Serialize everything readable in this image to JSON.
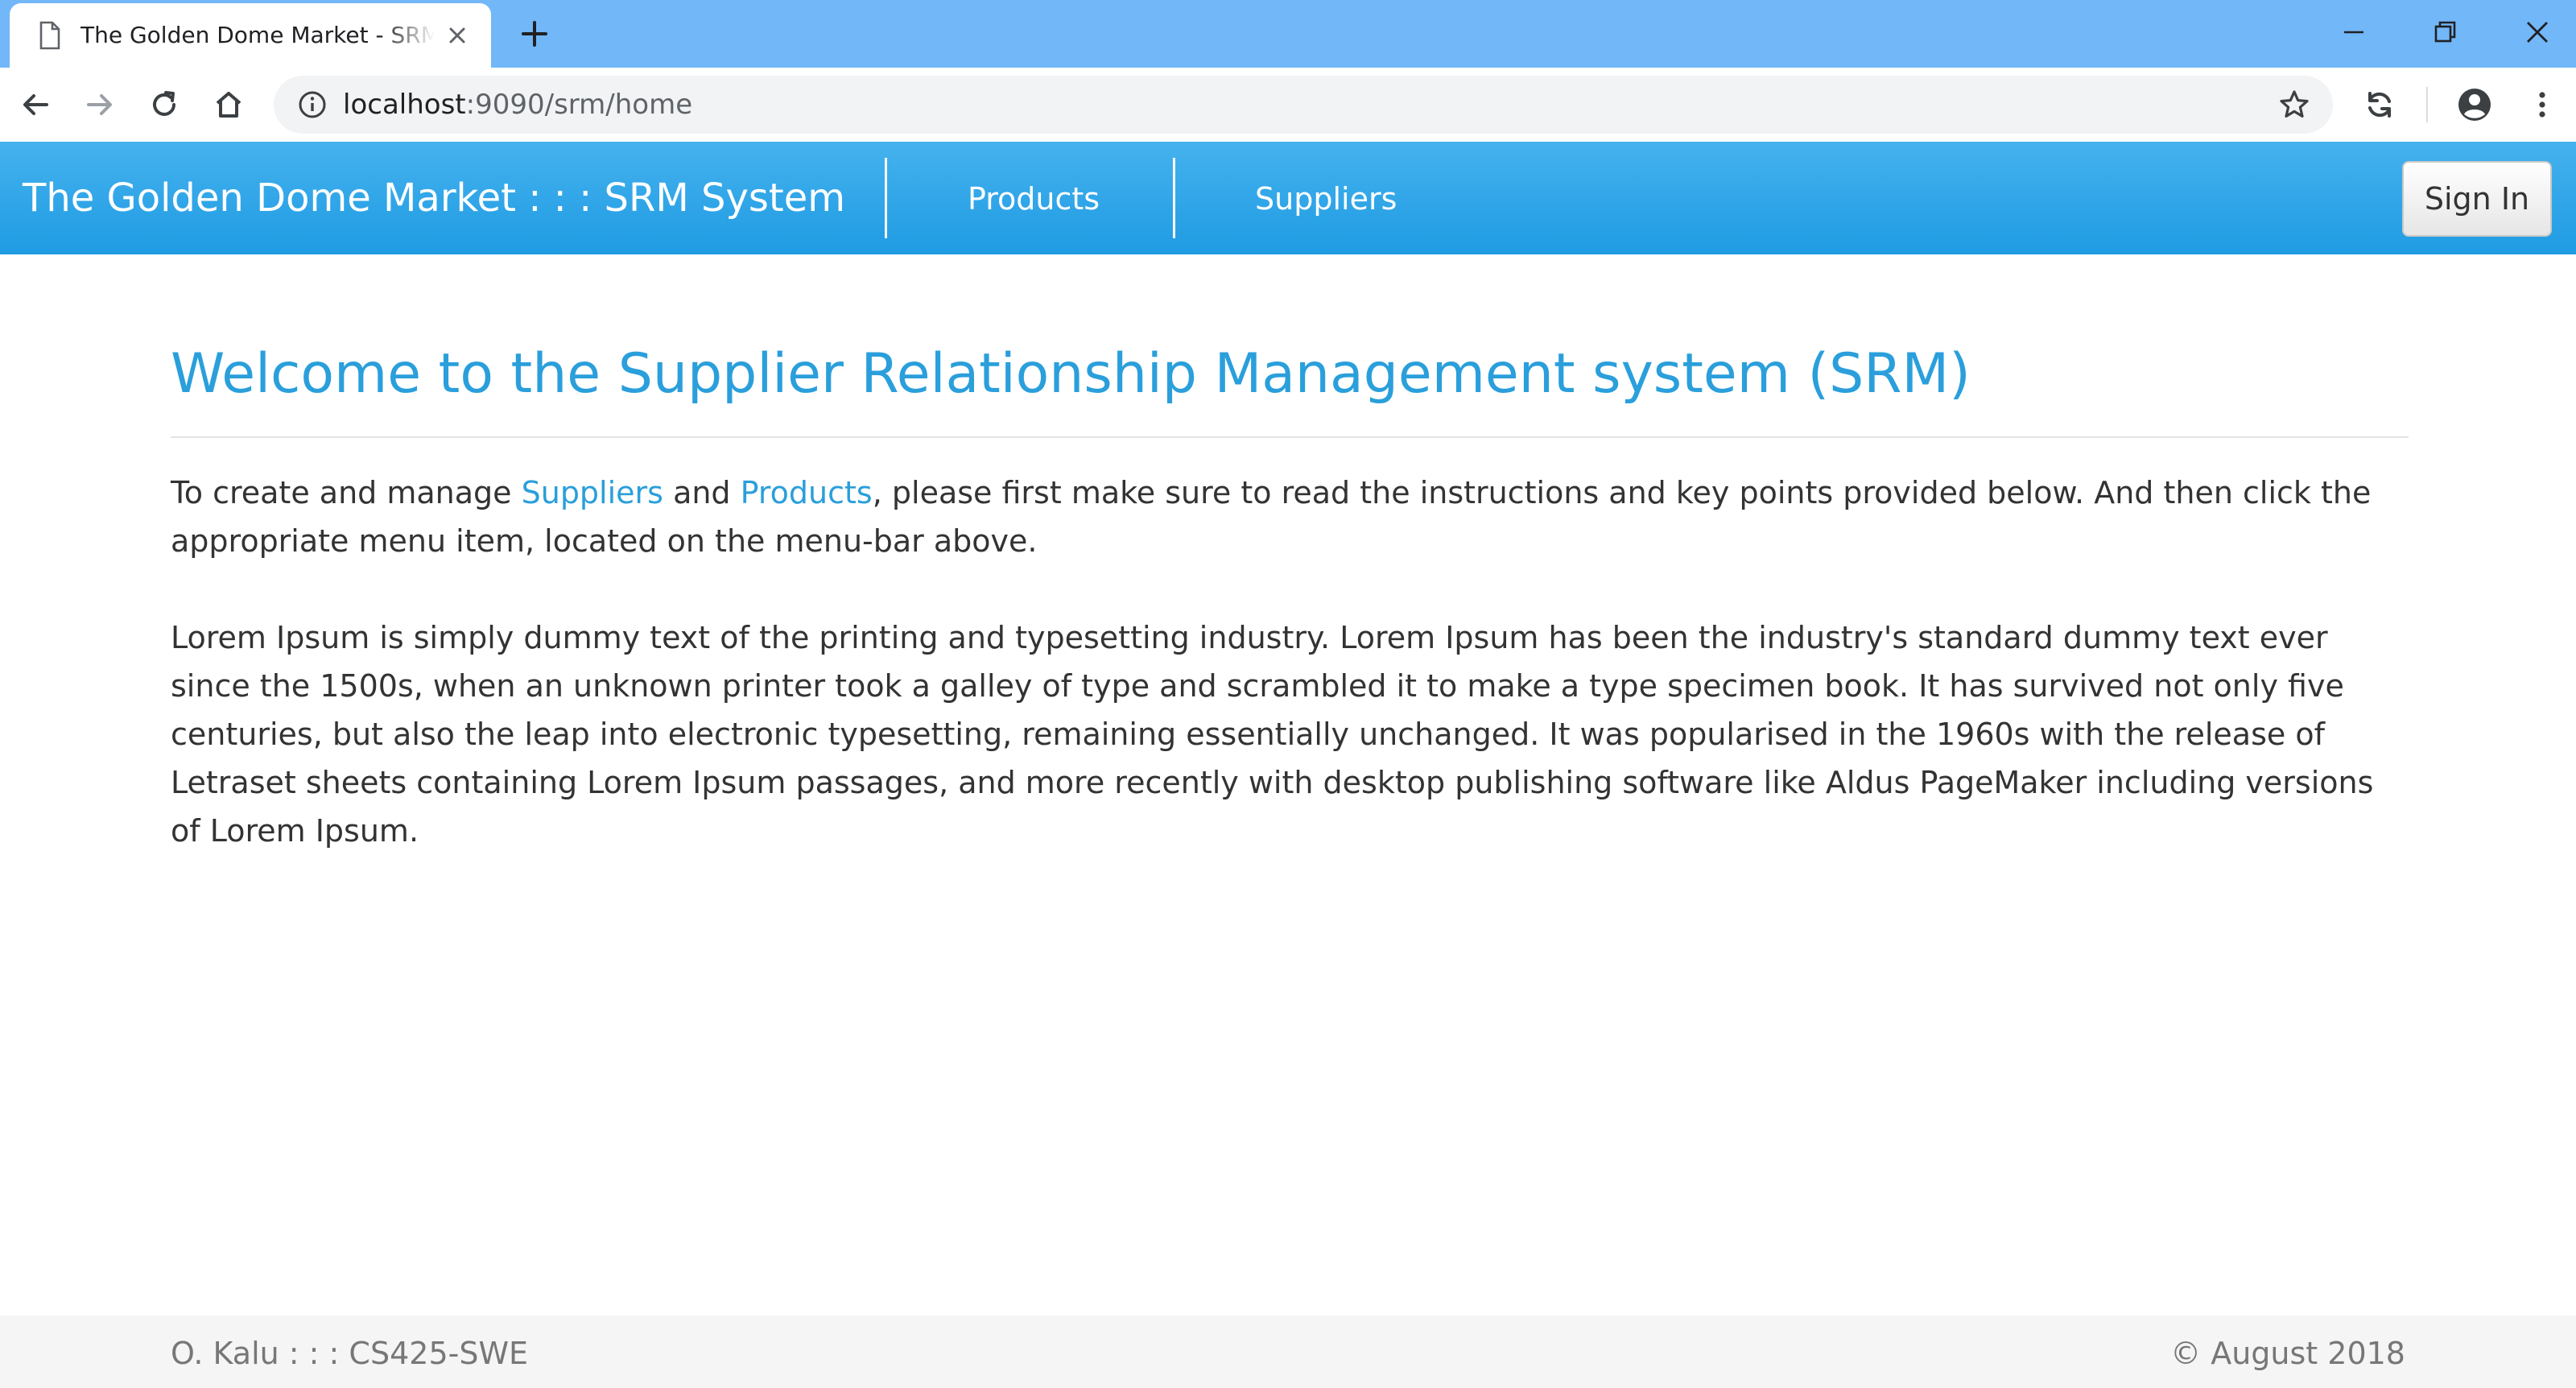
{
  "browser": {
    "tab_title": "The Golden Dome Market - SRM System",
    "address": {
      "host": "localhost",
      "rest": ":9090/srm/home"
    },
    "icons": {
      "tab": "document-icon",
      "tab_close": "close-icon",
      "new_tab": "plus-icon",
      "minimize": "minimize-icon",
      "restore": "restore-icon",
      "close_window": "close-window-icon",
      "back": "back-arrow-icon",
      "forward": "forward-arrow-icon",
      "reload": "reload-icon",
      "home": "home-icon",
      "site_info": "info-icon",
      "bookmark": "star-icon",
      "sync": "sync-icon",
      "profile": "account-icon",
      "menu": "kebab-menu-icon"
    },
    "colors": {
      "tabstrip": "#72b7f8",
      "omnibox": "#f1f3f4"
    }
  },
  "navbar": {
    "brand": "The Golden Dome Market : : : SRM System",
    "links": [
      {
        "label": "Products"
      },
      {
        "label": "Suppliers"
      }
    ],
    "signin_label": "Sign In",
    "colors": {
      "gradient_top": "#45b2ee",
      "gradient_bottom": "#1f9be3"
    }
  },
  "main": {
    "title": "Welcome to the Supplier Relationship Management system (SRM)",
    "intro": {
      "before": "To create and manage ",
      "link1": "Suppliers",
      "middle": " and ",
      "link2": "Products",
      "after": ", please first make sure to read the instructions and key points provided below. And then click the appropriate menu item, located on the menu-bar above."
    },
    "lorem": "Lorem Ipsum is simply dummy text of the printing and typesetting industry. Lorem Ipsum has been the industry's standard dummy text ever since the 1500s, when an unknown printer took a galley of type and scrambled it to make a type specimen book. It has survived not only five centuries, but also the leap into electronic typesetting, remaining essentially unchanged. It was popularised in the 1960s with the release of Letraset sheets containing Lorem Ipsum passages, and more recently with desktop publishing software like Aldus PageMaker including versions of Lorem Ipsum.",
    "colors": {
      "title": "#2a9fdb",
      "link": "#2a9fdb",
      "text": "#333333"
    }
  },
  "footer": {
    "left": "O. Kalu : : : CS425-SWE",
    "right": "© August 2018"
  }
}
